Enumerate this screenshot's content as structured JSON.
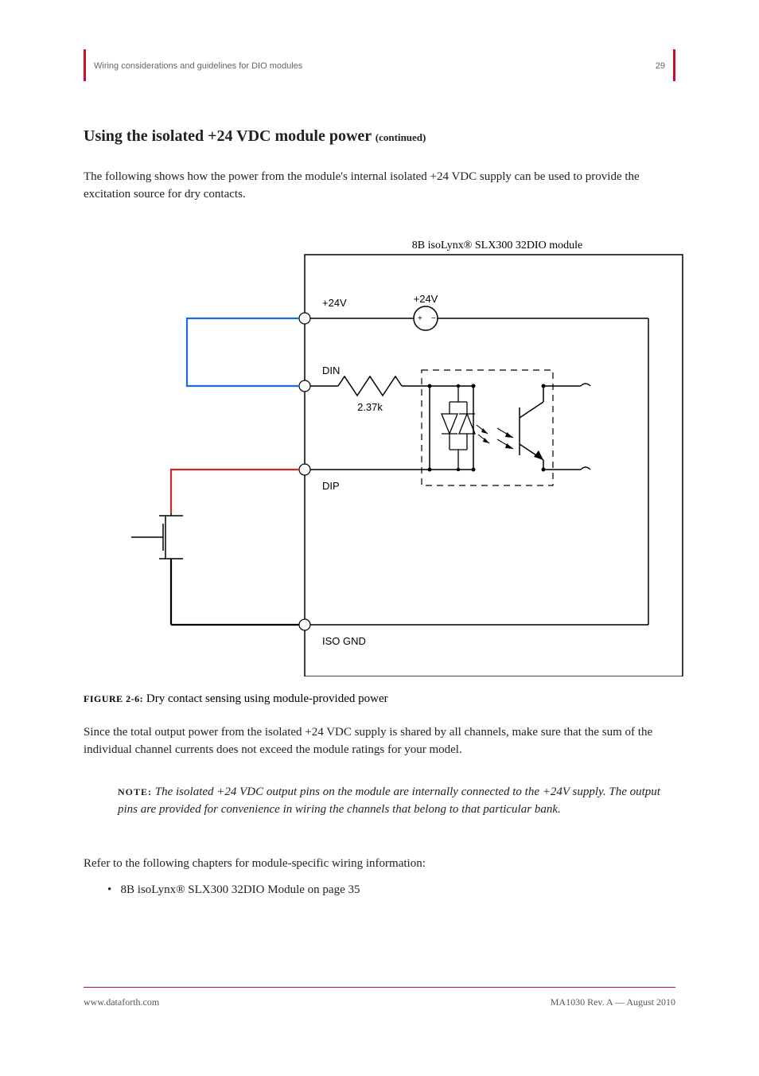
{
  "header": {
    "title": "Wiring considerations and guidelines for DIO modules",
    "page_right": "29"
  },
  "headings": {
    "h1": "Using the isolated +24 VDC module power",
    "h1_cont": "(continued)"
  },
  "paragraphs": {
    "p1": "The following shows how the power from the module's internal isolated +24 VDC supply can be used to provide the excitation source for dry contacts.",
    "p2": "Since the total output power from the isolated +24 VDC supply is shared by all channels, make sure that the sum of the individual channel currents does not exceed the module ratings for your model.",
    "p3": "Refer to the following chapters for module-specific wiring information:"
  },
  "figure": {
    "caption_label": "FIGURE 2-6:",
    "caption_text": "Dry contact sensing using module-provided power",
    "module_label": "8B isoLynx® SLX300 32DIO module",
    "pins": {
      "p24": "+24V",
      "din": "DIN",
      "dip": "DIP",
      "iso_gnd": "ISO GND"
    },
    "components": {
      "resistor": "2.37k",
      "vsrc": "+24V",
      "opto": "Optocoupler"
    }
  },
  "note": {
    "label": "NOTE:",
    "text": "The isolated +24 VDC output pins on the module are internally connected to the +24V supply. The output pins are provided for convenience in wiring the channels that belong to that particular bank."
  },
  "bullets": {
    "b1": "8B isoLynx® SLX300 32DIO Module on page 35"
  },
  "footer": {
    "company": "www.dataforth.com",
    "doc": "MA1030   Rev. A   —   August 2010"
  }
}
